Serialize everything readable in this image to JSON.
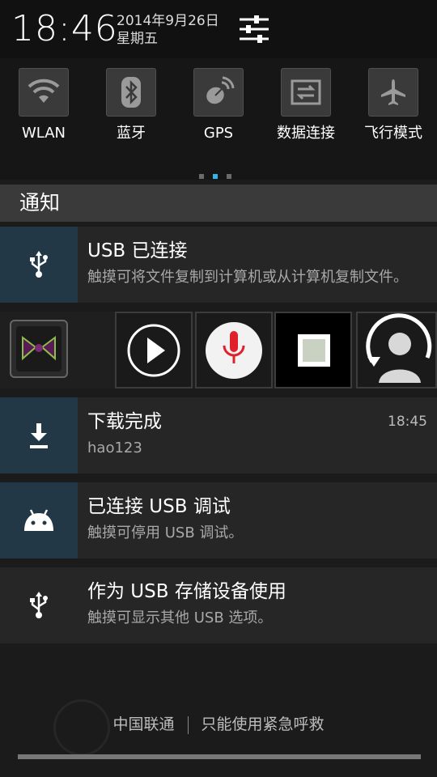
{
  "header": {
    "time": "18:46",
    "date": "2014年9月26日",
    "weekday": "星期五"
  },
  "quick_settings": [
    {
      "label": "WLAN",
      "icon": "wifi-icon"
    },
    {
      "label": "蓝牙",
      "icon": "bluetooth-icon"
    },
    {
      "label": "GPS",
      "icon": "gps-icon"
    },
    {
      "label": "数据连接",
      "icon": "data-connection-icon"
    },
    {
      "label": "飞行模式",
      "icon": "airplane-icon"
    }
  ],
  "pager": {
    "pages": 3,
    "active": 2
  },
  "notifications_title": "通知",
  "notifications": [
    {
      "title": "USB 已连接",
      "text": "触摸可将文件复制到计算机或从计算机复制文件。",
      "icon": "usb-icon"
    },
    {
      "title": "下载完成",
      "text": "hao123",
      "time": "18:45",
      "icon": "download-icon"
    },
    {
      "title": "已连接 USB 调试",
      "text": "触摸可停用 USB 调试。",
      "icon": "android-icon"
    },
    {
      "title": "作为 USB 存储设备使用",
      "text": "触摸可显示其他 USB 选项。",
      "icon": "usb-icon"
    }
  ],
  "media_controls": [
    "app-icon",
    "play-icon",
    "microphone-icon",
    "stop-icon",
    "user-refresh-icon"
  ],
  "footer": {
    "carrier": "中国联通",
    "status": "只能使用紧急呼救"
  },
  "colors": {
    "accent": "#33b5e5",
    "icon_cell": "#223846",
    "mic_red": "#e0202a"
  }
}
